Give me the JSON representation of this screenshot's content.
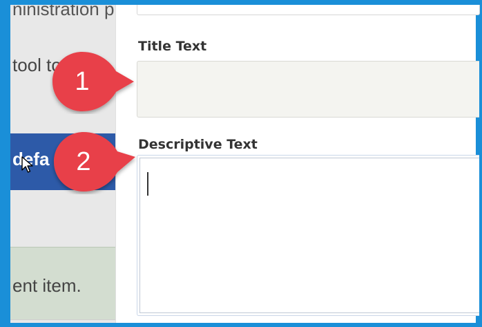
{
  "background_page": {
    "text_line_1": "ninistration p",
    "text_line_2": "tool to b  h",
    "button_fragment": "defa",
    "message_fragment": "ent item."
  },
  "form": {
    "title_label": "Title Text",
    "title_value": "",
    "description_label": "Descriptive Text",
    "description_value": ""
  },
  "callouts": [
    {
      "number": "1",
      "color": "#e8414a"
    },
    {
      "number": "2",
      "color": "#e8414a"
    }
  ],
  "colors": {
    "frame": "#1a8fd8",
    "background_button": "#2d5aa8",
    "callout": "#e8414a"
  },
  "icons": [
    "mouse-pointer-icon",
    "text-caret"
  ]
}
